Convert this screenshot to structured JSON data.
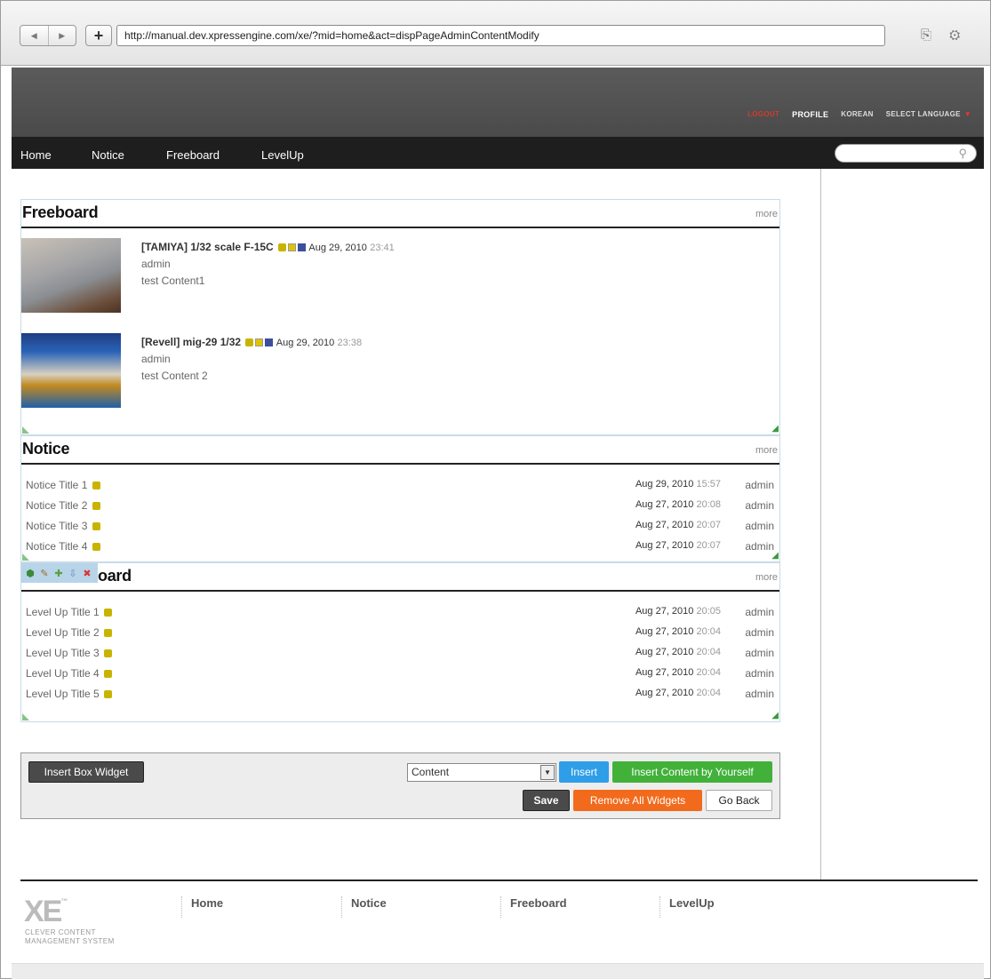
{
  "browser": {
    "url": "http://manual.dev.xpressengine.com/xe/?mid=home&act=dispPageAdminContentModify",
    "back": "◀",
    "forward": "▶",
    "new_tab": "+",
    "tools": "⎘ ⚙"
  },
  "header": {
    "logout": "LOGOUT",
    "profile": "PROFILE",
    "korean": "KOREAN",
    "select_language": "SELECT LANGUAGE",
    "menu": [
      "Home",
      "Notice",
      "Freeboard",
      "LevelUp"
    ]
  },
  "freeboard": {
    "title": "Freeboard",
    "more": "more",
    "posts": [
      {
        "title": "[TAMIYA] 1/32 scale F-15C",
        "date": "Aug 29, 2010",
        "time": "23:41",
        "author": "admin",
        "content": "test Content1"
      },
      {
        "title": "[Revell] mig-29 1/32",
        "date": "Aug 29, 2010",
        "time": "23:38",
        "author": "admin",
        "content": "test Content 2"
      }
    ]
  },
  "notice": {
    "title": "Notice",
    "more": "more",
    "rows": [
      {
        "title": "Notice Title 1",
        "date": "Aug 29, 2010",
        "time": "15:57",
        "author": "admin"
      },
      {
        "title": "Notice Title 2",
        "date": "Aug 27, 2010",
        "time": "20:08",
        "author": "admin"
      },
      {
        "title": "Notice Title 3",
        "date": "Aug 27, 2010",
        "time": "20:07",
        "author": "admin"
      },
      {
        "title": "Notice Title 4",
        "date": "Aug 27, 2010",
        "time": "20:07",
        "author": "admin"
      }
    ]
  },
  "levelup": {
    "title": "oard",
    "more": "more",
    "rows": [
      {
        "title": "Level Up Title 1",
        "date": "Aug 27, 2010",
        "time": "20:05",
        "author": "admin"
      },
      {
        "title": "Level Up Title 2",
        "date": "Aug 27, 2010",
        "time": "20:04",
        "author": "admin"
      },
      {
        "title": "Level Up Title 3",
        "date": "Aug 27, 2010",
        "time": "20:04",
        "author": "admin"
      },
      {
        "title": "Level Up Title 4",
        "date": "Aug 27, 2010",
        "time": "20:04",
        "author": "admin"
      },
      {
        "title": "Level Up Title 5",
        "date": "Aug 27, 2010",
        "time": "20:04",
        "author": "admin"
      }
    ]
  },
  "panel": {
    "insert_box_widget": "Insert Box Widget",
    "select_value": "Content",
    "insert": "Insert",
    "insert_content": "Insert Content by Yourself",
    "save": "Save",
    "remove_all": "Remove All Widgets",
    "go_back": "Go Back"
  },
  "footer": {
    "logo": "XE",
    "tm": "™",
    "tagline_1": "CLEVER CONTENT",
    "tagline_2": "MANAGEMENT SYSTEM",
    "menu": [
      "Home",
      "Notice",
      "Freeboard",
      "LevelUp"
    ]
  },
  "colors": {
    "accent_green": "#41b13a",
    "accent_blue": "#2f9ee8",
    "accent_orange": "#f26b1d",
    "logout_red": "#d63a2a"
  }
}
